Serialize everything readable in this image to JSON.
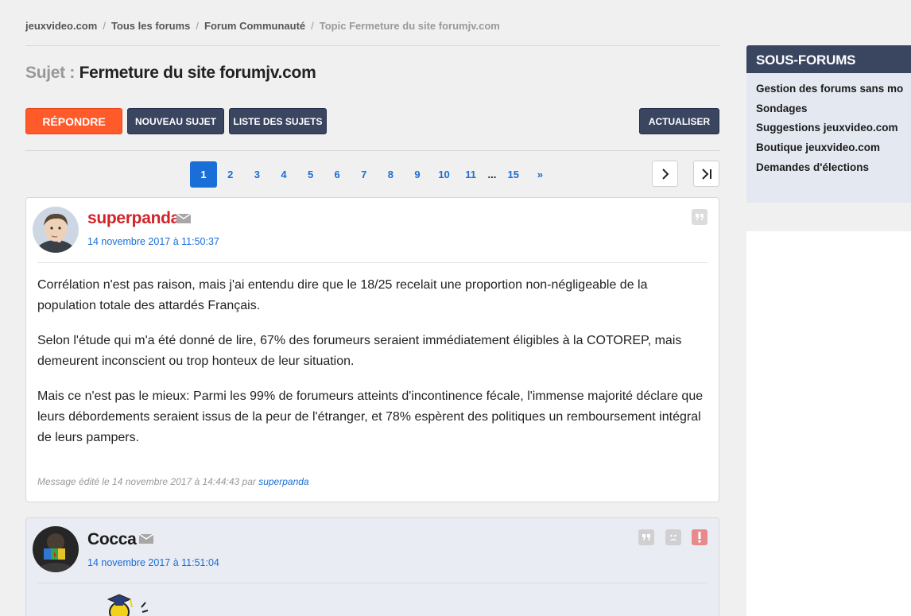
{
  "breadcrumb": {
    "items": [
      "jeuxvideo.com",
      "Tous les forums",
      "Forum Communauté"
    ],
    "current": "Topic Fermeture du site forumjv.com",
    "separator": "/"
  },
  "subject": {
    "label": "Sujet :",
    "title": "Fermeture du site forumjv.com"
  },
  "toolbar": {
    "reply": "Répondre",
    "new_topic": "Nouveau sujet",
    "topic_list": "Liste des sujets",
    "refresh": "Actualiser"
  },
  "pagination": {
    "pages": [
      "1",
      "2",
      "3",
      "4",
      "5",
      "6",
      "7",
      "8",
      "9",
      "10",
      "11"
    ],
    "current": "1",
    "ellipsis": "...",
    "last": "15",
    "more": "»",
    "next_icon": "chevron-right-icon",
    "last_icon": "last-page-icon"
  },
  "posts": [
    {
      "author": "superpanda",
      "author_color": "#d2232a",
      "date": "14 novembre 2017 à 11:50:37",
      "paragraphs": [
        "Corrélation n'est pas raison, mais j'ai entendu dire que le 18/25 recelait une proportion non-négligeable de la population totale des attardés Français.",
        "Selon l'étude qui m'a été donné de lire, 67% des forumeurs seraient immédiatement éligibles à la COTOREP, mais demeurent inconscient ou trop honteux de leur situation.",
        "Mais ce n'est pas le mieux: Parmi les 99% de forumeurs atteints d'incontinence fécale, l'immense majorité déclare que leurs débordements seraient issus de la peur de l'étranger, et 78% espèrent des politiques un remboursement intégral de leurs pampers."
      ],
      "edited_prefix": "Message édité le 14 novembre 2017 à 14:44:43 par",
      "edited_by": "superpanda"
    },
    {
      "author": "Cocca",
      "author_color": "#1b1b1b",
      "date": "14 novembre 2017 à 11:51:04"
    }
  ],
  "sidebar": {
    "title": "Sous-forums",
    "items": [
      "Gestion des forums sans mo",
      "Sondages",
      "Suggestions jeuxvideo.com",
      "Boutique jeuxvideo.com",
      "Demandes d'élections"
    ]
  },
  "colors": {
    "accent_blue": "#1a6ed8",
    "button_orange": "#ff5a2a",
    "button_dark": "#3a4560"
  }
}
